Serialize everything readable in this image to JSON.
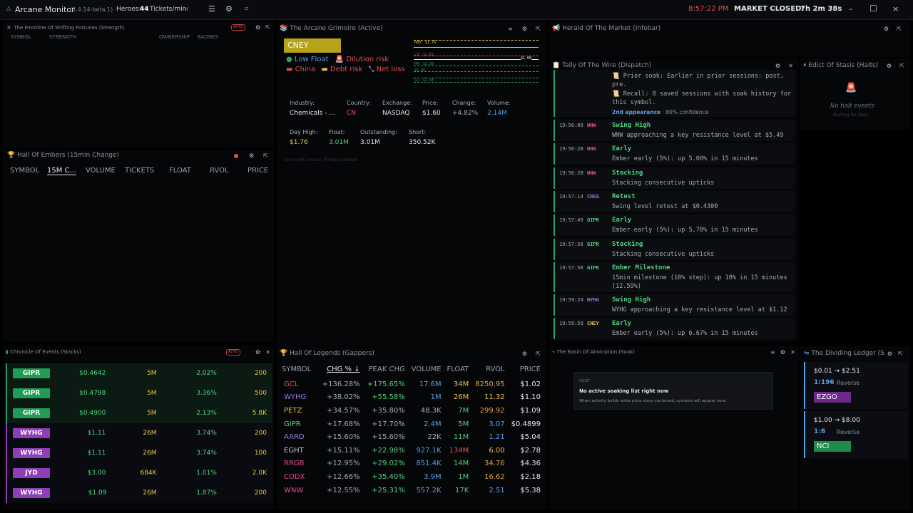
{
  "topbar": {
    "app_title": "Arcane Monitor",
    "version": "(5.4.14-beta.1)",
    "heroes_label": "Heroes:",
    "heroes_value": "44",
    "tickets_label": "Tickets/min:",
    "tickets_value": "–",
    "clock": "8:57:22 PM",
    "market_label": "MARKET CLOSED:",
    "market_timer": "7h 2m 38s"
  },
  "frontline": {
    "title": "The Frontline Of Shifting Fortunes (Strength)",
    "auto": "AUTO",
    "cols": [
      "SYMBOL",
      "STRENGTH",
      "OWNERSHIP",
      "BADGES"
    ]
  },
  "embers": {
    "title": "Hall Of Embers (15min Change)",
    "cols": [
      "SYMBOL",
      "15M C...",
      "VOLUME",
      "TICKETS",
      "FLOAT",
      "RVOL",
      "PRICE"
    ]
  },
  "grimoire": {
    "title": "The Arcane Grimoire (Active)",
    "symbol": "CNEY",
    "flags": [
      "Low Float",
      "Dilution risk",
      "China",
      "Debt risk",
      "Net loss"
    ],
    "levels": [
      "HOD: $1.76",
      "$1.60",
      "LO: $1.63",
      "PM: $1.58",
      "$1.45",
      "LL: $1.43"
    ],
    "industry_label": "Industry:",
    "industry": "Chemicals - ...",
    "country_label": "Country:",
    "country": "CN",
    "exchange_label": "Exchange:",
    "exchange": "NASDAQ",
    "price_label": "Price:",
    "price": "$1.60",
    "change_label": "Change:",
    "change": "+4.82%",
    "volume_label": "Volume:",
    "volume": "2.14M",
    "dayhigh_label": "Day High:",
    "dayhigh": "$1.76",
    "float_label": "Float:",
    "float": "3.01M",
    "outstanding_label": "Outstanding:",
    "outstanding": "3.01M",
    "short_label": "Short:",
    "short": "350.52K",
    "news": "no recent news or filings available"
  },
  "herald": {
    "title": "Herald Of The Market (Infobar)"
  },
  "wire": {
    "title": "Tally Of The Wire (Dispatch)",
    "top_lines": [
      "📜 Prior soak: Earlier in prior sessions: post, pre.",
      "📜 Recall: 8 saved sessions with soak history for this symbol."
    ],
    "appearance": "2nd appearance",
    "confidence": "· 80% confidence",
    "events": [
      {
        "time": "19:56:09",
        "sym": "WNW",
        "color": "#e0528c",
        "title": "Swing High",
        "body": "WNW approaching a key resistance level at $5.49"
      },
      {
        "time": "19:56:28",
        "sym": "WNW",
        "color": "#e0528c",
        "title": "Early",
        "body": "Ember early (5%): up 5.08% in 15 minutes"
      },
      {
        "time": "19:56:28",
        "sym": "WNW",
        "color": "#e0528c",
        "title": "Stacking",
        "body": "Stacking consecutive upticks"
      },
      {
        "time": "19:57:14",
        "sym": "CREG",
        "color": "#9b7be0",
        "title": "Retest",
        "body": "Swing level retest at $0.4300"
      },
      {
        "time": "19:57:49",
        "sym": "GIPR",
        "color": "#4fd37f",
        "title": "Early",
        "body": "Ember early (5%): up 5.70% in 15 minutes"
      },
      {
        "time": "19:57:58",
        "sym": "GIPR",
        "color": "#4fd37f",
        "title": "Stacking",
        "body": "Stacking consecutive upticks"
      },
      {
        "time": "19:57:58",
        "sym": "GIPR",
        "color": "#4fd37f",
        "title": "Ember Milestone",
        "body": "15min milestone (10% step): up 10% in 15 minutes (12.59%)"
      },
      {
        "time": "19:59:24",
        "sym": "WYHG",
        "color": "#9b7be0",
        "title": "Swing High",
        "body": "WYHG approaching a key resistance level at $1.12"
      },
      {
        "time": "19:59:59",
        "sym": "CNEY",
        "color": "#e6c34a",
        "title": "Early",
        "body": "Ember early (5%): up 6.67% in 15 minutes"
      }
    ]
  },
  "stasis": {
    "title": "Edict Of Stasis (Halts)",
    "empty": "No halt events",
    "sub": "Waiting for data..."
  },
  "chronicle": {
    "title": "Chronicle Of Events (Stacks)",
    "auto": "AUTO",
    "rows": [
      {
        "sym": "GIPR",
        "bg": "#1f9d55",
        "price": "$0.4642",
        "float": "5M",
        "pct": "2.02%",
        "qty": "200"
      },
      {
        "sym": "GIPR",
        "bg": "#1f9d55",
        "price": "$0.4798",
        "float": "5M",
        "pct": "3.36%",
        "qty": "500"
      },
      {
        "sym": "GIPR",
        "bg": "#1f9d55",
        "price": "$0.4900",
        "float": "5M",
        "pct": "2.13%",
        "qty": "5.8K"
      },
      {
        "sym": "WYHG",
        "bg": "#8e3fb8",
        "price": "$1.11",
        "float": "26M",
        "pct": "3.74%",
        "qty": "200"
      },
      {
        "sym": "WYHG",
        "bg": "#8e3fb8",
        "price": "$1.11",
        "float": "26M",
        "pct": "3.74%",
        "qty": "100"
      },
      {
        "sym": "JYD",
        "bg": "#8e3fb8",
        "price": "$3.00",
        "float": "684K",
        "pct": "1.01%",
        "qty": "2.0K"
      },
      {
        "sym": "WYHG",
        "bg": "#8e3fb8",
        "price": "$1.09",
        "float": "26M",
        "pct": "1.87%",
        "qty": "200"
      }
    ]
  },
  "legends": {
    "title": "Hall Of Legends (Gappers)",
    "cols": [
      "SYMBOL",
      "CHG % ↓",
      "PEAK CHG",
      "VOLUME",
      "FLOAT",
      "RVOL",
      "PRICE"
    ],
    "rows": [
      {
        "sym": "GCL",
        "sc": "#e05252",
        "chg": "+136.28%",
        "peak": "+175.65%",
        "pc": "#4fd37f",
        "vol": "17.6M",
        "vc": "#5aa0e6",
        "flt": "34M",
        "fc": "#e6c34a",
        "rvol": "8250.95",
        "rc": "#e6a34a",
        "price": "$1.02"
      },
      {
        "sym": "WYHG",
        "sc": "#9b7be0",
        "chg": "+38.02%",
        "peak": "+55.58%",
        "pc": "#4fd37f",
        "vol": "1M",
        "vc": "#5aa0e6",
        "flt": "26M",
        "fc": "#e6c34a",
        "rvol": "11.32",
        "rc": "#e6c34a",
        "price": "$1.10"
      },
      {
        "sym": "PETZ",
        "sc": "#e6c34a",
        "chg": "+34.57%",
        "peak": "+35.80%",
        "pc": "#a6abb3",
        "vol": "48.3K",
        "vc": "#a6abb3",
        "flt": "7M",
        "fc": "#4fd37f",
        "rvol": "299.92",
        "rc": "#e6a34a",
        "price": "$1.09"
      },
      {
        "sym": "GIPR",
        "sc": "#4fd37f",
        "chg": "+17.68%",
        "peak": "+17.70%",
        "pc": "#a6abb3",
        "vol": "2.4M",
        "vc": "#5aa0e6",
        "flt": "5M",
        "fc": "#4fd37f",
        "rvol": "3.07",
        "rc": "#5aa0e6",
        "price": "$0.4899"
      },
      {
        "sym": "AARD",
        "sc": "#9b7be0",
        "chg": "+15.60%",
        "peak": "+15.60%",
        "pc": "#a6abb3",
        "vol": "22K",
        "vc": "#a6abb3",
        "flt": "11M",
        "fc": "#4fd37f",
        "rvol": "1.21",
        "rc": "#5aa0e6",
        "price": "$5.04"
      },
      {
        "sym": "EGHT",
        "sc": "#c8ccd2",
        "chg": "+15.11%",
        "peak": "+22.98%",
        "pc": "#4fd37f",
        "vol": "927.1K",
        "vc": "#5aa0e6",
        "flt": "134M",
        "fc": "#e05252",
        "rvol": "6.00",
        "rc": "#e6c34a",
        "price": "$2.78"
      },
      {
        "sym": "RRGB",
        "sc": "#e0528c",
        "chg": "+12.95%",
        "peak": "+29.02%",
        "pc": "#4fd37f",
        "vol": "851.4K",
        "vc": "#5aa0e6",
        "flt": "14M",
        "fc": "#4fd37f",
        "rvol": "34.76",
        "rc": "#e6a34a",
        "price": "$4.36"
      },
      {
        "sym": "CODX",
        "sc": "#e0528c",
        "chg": "+12.66%",
        "peak": "+35.40%",
        "pc": "#4fd37f",
        "vol": "3.9M",
        "vc": "#5aa0e6",
        "flt": "1M",
        "fc": "#4fd37f",
        "rvol": "16.62",
        "rc": "#e6a34a",
        "price": "$2.18"
      },
      {
        "sym": "WNW",
        "sc": "#e0528c",
        "chg": "+12.55%",
        "peak": "+25.31%",
        "pc": "#4fd37f",
        "vol": "557.2K",
        "vc": "#5aa0e6",
        "flt": "17K",
        "fc": "#4fd37f",
        "rvol": "2.51",
        "rc": "#5aa0e6",
        "price": "$5.38"
      }
    ]
  },
  "soak": {
    "title": "The Basin Of Absorption (Soak)",
    "tag": "QUIET",
    "heading": "No active soaking list right now",
    "sub": "When activity builds while price stays contained, symbols will appear here."
  },
  "ledger": {
    "title": "The Dividing Ledger (S",
    "cards": [
      {
        "range": "$0.01 → $2.51",
        "ratio": "1:196",
        "type": "Reverse",
        "sym": "EZGO",
        "bg": "#6a2a8a"
      },
      {
        "range": "$1.00 → $8.00",
        "ratio": "1:8",
        "type": "Reverse",
        "sym": "NCI",
        "bg": "#1f8a4a"
      }
    ]
  }
}
